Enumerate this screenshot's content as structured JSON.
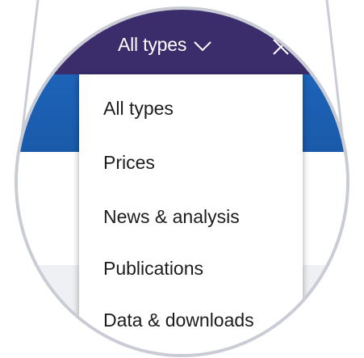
{
  "filter": {
    "selected_label": "All types",
    "options": [
      {
        "label": "All types"
      },
      {
        "label": "Prices"
      },
      {
        "label": "News & analysis"
      },
      {
        "label": "Publications"
      },
      {
        "label": "Data & downloads"
      }
    ]
  },
  "colors": {
    "header_bg": "#3b2d6b",
    "blue_band": "#1d63b8",
    "menu_bg": "#ffffff",
    "menu_text": "#1c1c1c",
    "lens_border": "#c9ccd4"
  },
  "icons": {
    "dropdown": "chevron-down-icon",
    "close": "close-icon"
  }
}
